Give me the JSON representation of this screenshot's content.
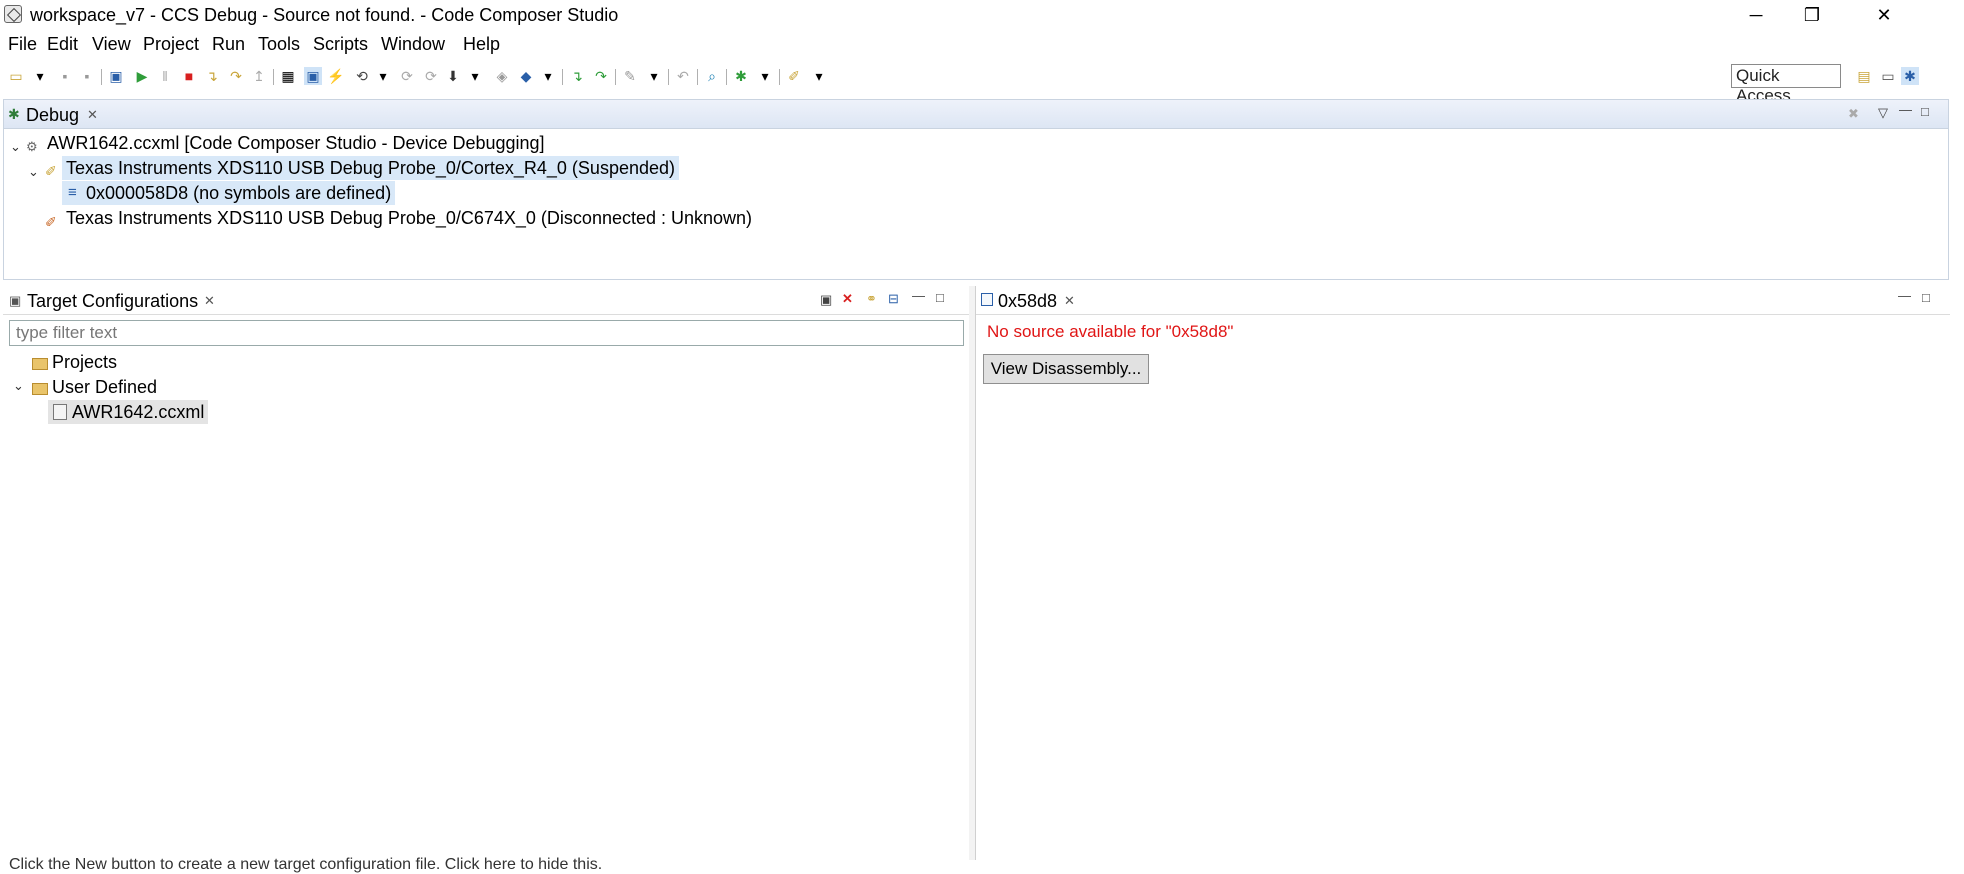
{
  "window": {
    "title": "workspace_v7 - CCS Debug - Source not found. - Code Composer Studio",
    "minimize_glyph": "─",
    "restore_glyph": "❐",
    "close_glyph": "✕"
  },
  "menu": [
    "File",
    "Edit",
    "View",
    "Project",
    "Run",
    "Tools",
    "Scripts",
    "Window",
    "Help"
  ],
  "toolbar": {
    "quick_access": "Quick Access"
  },
  "debug_view": {
    "tab_label": "Debug",
    "tree": {
      "root": "AWR1642.ccxml [Code Composer Studio - Device Debugging]",
      "core_r4": "Texas Instruments XDS110 USB Debug Probe_0/Cortex_R4_0 (Suspended)",
      "frame": "0x000058D8  (no symbols are defined)",
      "core_c674x": "Texas Instruments XDS110 USB Debug Probe_0/C674X_0 (Disconnected : Unknown)"
    }
  },
  "target_configurations": {
    "tab_label": "Target Configurations",
    "filter_placeholder": "type filter text",
    "tree": {
      "projects": "Projects",
      "user_defined": "User Defined",
      "file": "AWR1642.ccxml"
    },
    "hint": "Click the New button to create a new target configuration file. Click here to hide this."
  },
  "editor": {
    "tab_label": "0x58d8",
    "message": "No source available for \"0x58d8\"",
    "button_label": "View Disassembly..."
  },
  "colors": {
    "error_text": "#e01515",
    "selection": "#d8e8f8",
    "debug_header": "#dde6f4"
  }
}
